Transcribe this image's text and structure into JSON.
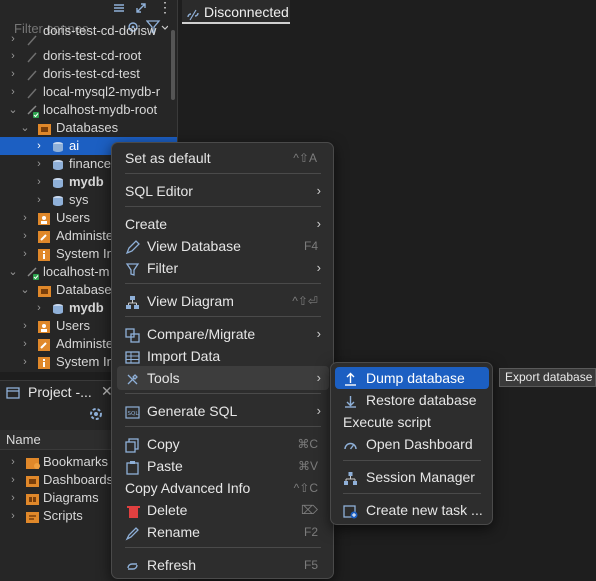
{
  "navigator": {
    "filter_placeholder": "Filter connec",
    "items": [
      {
        "label": "doris-test-cd-dorisw",
        "top": 0
      },
      {
        "label": "doris-test-cd-root"
      },
      {
        "label": "doris-test-cd-test"
      },
      {
        "label": "local-mysql2-mydb-r"
      },
      {
        "label": "localhost-mydb-root"
      },
      {
        "label": "Databases"
      },
      {
        "label": "ai"
      },
      {
        "label": "finance"
      },
      {
        "label": "mydb"
      },
      {
        "label": "sys"
      },
      {
        "label": "Users"
      },
      {
        "label": "Administe"
      },
      {
        "label": "System In"
      },
      {
        "label": "localhost-m"
      },
      {
        "label": "Databases"
      },
      {
        "label": "mydb"
      },
      {
        "label": "Users"
      },
      {
        "label": "Administe"
      },
      {
        "label": "System In"
      }
    ]
  },
  "project": {
    "tab_label": "Project -...",
    "column_header": "Name",
    "items": [
      "Bookmarks",
      "Dashboards",
      "Diagrams",
      "Scripts"
    ]
  },
  "editor": {
    "tab_label": "Disconnected"
  },
  "context_menu": {
    "items": [
      {
        "label": "Set as default",
        "shortcut": "^⇧A"
      },
      {
        "label": "SQL Editor",
        "arrow": "›"
      },
      {
        "label": "Create",
        "arrow": "›"
      },
      {
        "label": "View Database",
        "shortcut": "F4"
      },
      {
        "label": "Filter",
        "arrow": "›"
      },
      {
        "label": "View Diagram",
        "shortcut": "^⇧⏎"
      },
      {
        "label": "Compare/Migrate",
        "arrow": "›"
      },
      {
        "label": "Import Data"
      },
      {
        "label": "Tools",
        "arrow": "›"
      },
      {
        "label": "Generate SQL",
        "arrow": "›"
      },
      {
        "label": "Copy",
        "shortcut": "⌘C"
      },
      {
        "label": "Paste",
        "shortcut": "⌘V"
      },
      {
        "label": "Copy Advanced Info",
        "shortcut": "^⇧C"
      },
      {
        "label": "Delete",
        "shortcut": "⌦"
      },
      {
        "label": "Rename",
        "shortcut": "F2"
      },
      {
        "label": "Refresh",
        "shortcut": "F5"
      }
    ]
  },
  "tools_submenu": {
    "items": [
      {
        "label": "Dump database"
      },
      {
        "label": "Restore database"
      },
      {
        "label": "Execute script"
      },
      {
        "label": "Open Dashboard"
      },
      {
        "label": "Session Manager"
      },
      {
        "label": "Create new task ..."
      }
    ]
  },
  "tooltip": {
    "text": "Export database"
  },
  "colors": {
    "selection": "#1c5fc2",
    "folder": "#e0882a",
    "db": "#8fb0d8"
  }
}
